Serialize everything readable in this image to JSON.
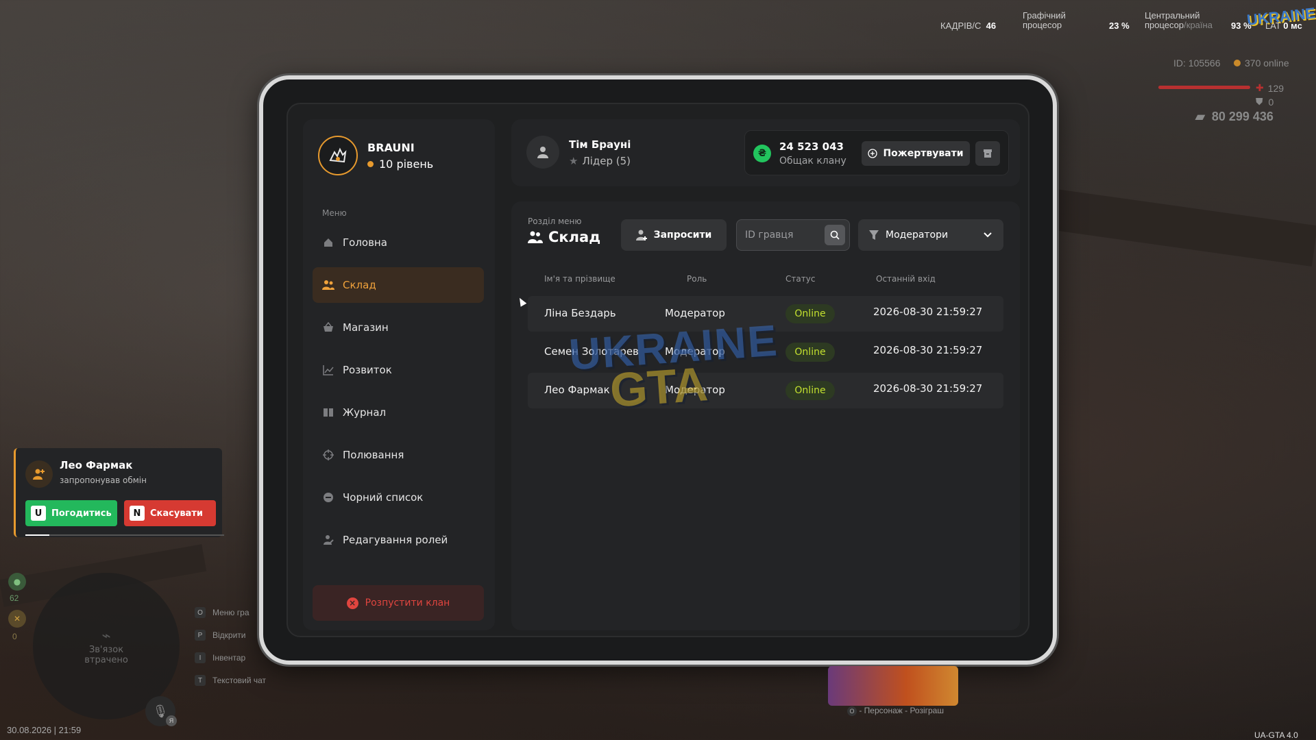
{
  "hud": {
    "fps_label": "КАДРІВ/С",
    "fps_value": "46",
    "gpu_label_1": "Графічний",
    "gpu_label_2": "процесор",
    "gpu_value": "23 %",
    "cpu_label_1": "Центральний",
    "cpu_label_2": "процесор",
    "server_partial": "/країна",
    "cpu_value": "93 %",
    "lat_label": "LAT",
    "lat_value": "0 мс",
    "logo_text": "UKRAINE",
    "player_id": "ID: 105566",
    "online": "370 online",
    "health": "129",
    "armor": "0",
    "money": "80 299 436"
  },
  "clan": {
    "name": "BRAUNI",
    "level": "10 рівень"
  },
  "menu": {
    "caption": "Меню",
    "items": [
      {
        "label": "Головна",
        "icon": "home-icon"
      },
      {
        "label": "Склад",
        "icon": "members-icon",
        "active": true
      },
      {
        "label": "Магазин",
        "icon": "basket-icon"
      },
      {
        "label": "Розвиток",
        "icon": "chart-icon"
      },
      {
        "label": "Журнал",
        "icon": "book-icon"
      },
      {
        "label": "Полювання",
        "icon": "crosshair-icon"
      },
      {
        "label": "Чорний список",
        "icon": "block-icon"
      },
      {
        "label": "Редагування ролей",
        "icon": "user-edit-icon"
      }
    ],
    "disband_label": "Розпустити клан"
  },
  "player": {
    "name": "Тім Брауні",
    "role": "Лідер (5)"
  },
  "bank": {
    "currency_symbol": "₴",
    "amount": "24 523 043",
    "label": "Общак клану",
    "donate_label": "Пожертвувати"
  },
  "section": {
    "caption": "Розділ меню",
    "title": "Склад",
    "invite_label": "Запросити",
    "search_placeholder": "ID гравця",
    "filter_value": "Модератори"
  },
  "table": {
    "headers": [
      "Ім'я та прізвище",
      "Роль",
      "Статус",
      "Останній вхід"
    ],
    "rows": [
      {
        "name": "Ліна Бездарь",
        "role": "Модератор",
        "status": "Online",
        "last_login": "2026-08-30 21:59:27"
      },
      {
        "name": "Семен Золотарев",
        "role": "Модератор",
        "status": "Online",
        "last_login": "2026-08-30 21:59:27"
      },
      {
        "name": "Лео Фармак",
        "role": "Модератор",
        "status": "Online",
        "last_login": "2026-08-30 21:59:27"
      }
    ]
  },
  "watermark": {
    "line1": "UKRAINE",
    "line2": "GTA"
  },
  "trade": {
    "name": "Лео Фармак",
    "text": "запропонував обмін",
    "accept_key": "U",
    "accept_label": "Погодитись",
    "cancel_key": "N",
    "cancel_label": "Скасувати",
    "progress": 0.12
  },
  "minimap": {
    "lost_1": "Зв'язок",
    "lost_2": "втрачено",
    "status_value": "0"
  },
  "hints": [
    {
      "key": "O",
      "label": "Меню гра"
    },
    {
      "key": "P",
      "label": "Відкрити"
    },
    {
      "key": "I",
      "label": "Інвентар"
    },
    {
      "key": "T",
      "label": "Текстовий чат"
    }
  ],
  "mic_badge": "Я",
  "datetime": "30.08.2026 | 21:59",
  "promo": {
    "label": "- Персонаж - Розіграш",
    "key": "O"
  },
  "version": "UA-GTA 4.0",
  "colors": {
    "accent": "#f0a23b",
    "online": "#c3e02f",
    "danger": "#e0453f",
    "money": "#22c55e"
  }
}
